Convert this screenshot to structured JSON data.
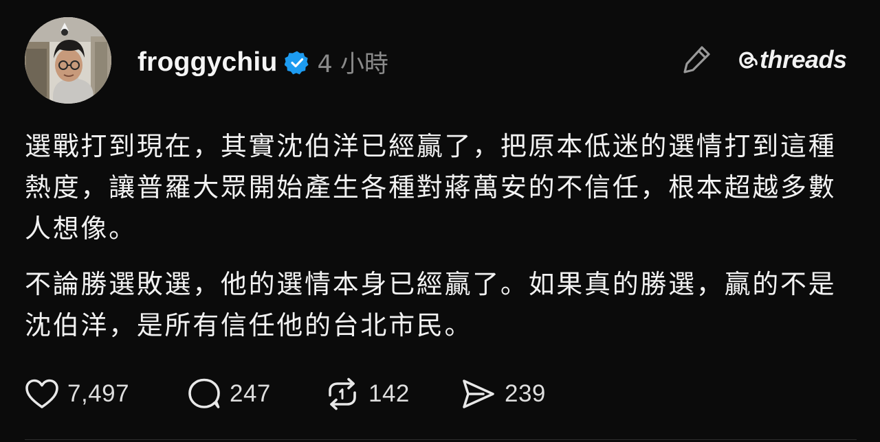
{
  "post": {
    "author": {
      "username": "froggychiu",
      "verified": true,
      "avatar_icon": "profile-photo"
    },
    "timestamp": "4 小時",
    "paragraphs": [
      "選戰打到現在，其實沈伯洋已經贏了，把原本低迷的選情打到這種熱度，讓普羅大眾開始產生各種對蔣萬安的不信任，根本超越多數人想像。",
      "不論勝選敗選，他的選情本身已經贏了。如果真的勝選，贏的不是沈伯洋，是所有信任他的台北市民。"
    ],
    "stats": {
      "likes": "7,497",
      "replies": "247",
      "reposts": "142",
      "shares": "239"
    }
  },
  "branding": {
    "logo_text": "threads",
    "logo_icon": "threads-at-icon"
  },
  "icons": {
    "verified": "verified-badge-icon",
    "edit": "pencil-icon",
    "like": "heart-icon",
    "reply": "speech-bubble-icon",
    "repost": "repost-arrows-icon",
    "share": "send-icon"
  },
  "colors": {
    "background": "#0b0b0b",
    "text": "#f3f3f3",
    "muted": "#8a8a8a",
    "verified": "#1d9bf0"
  }
}
